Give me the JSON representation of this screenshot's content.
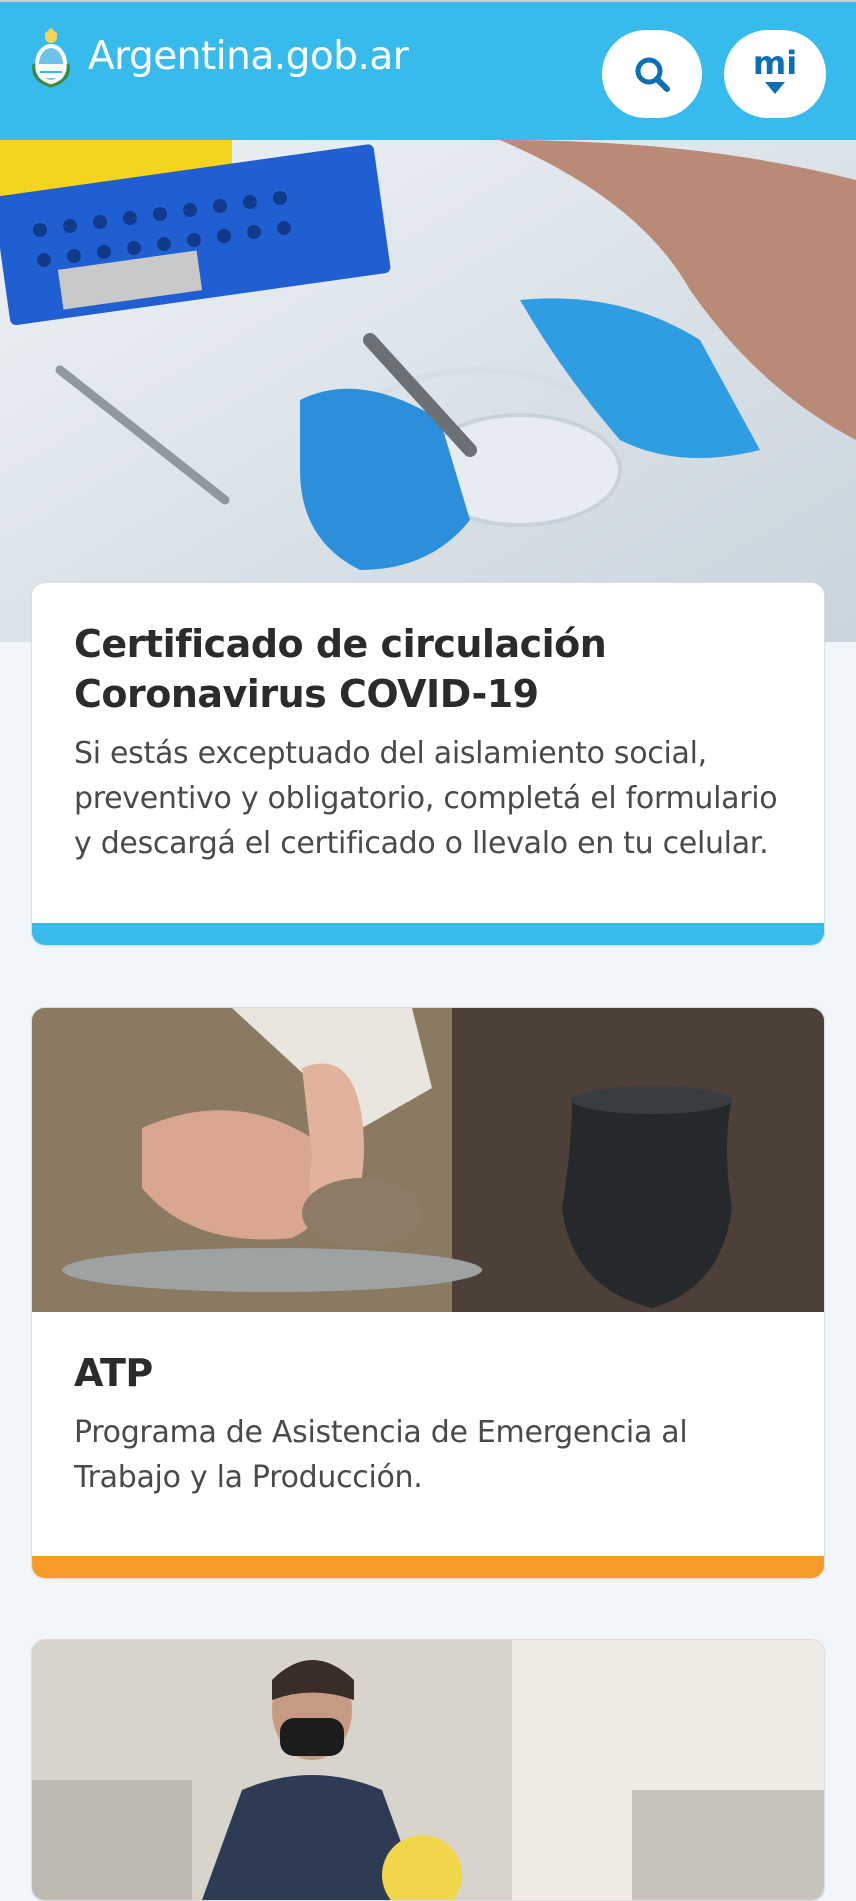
{
  "header": {
    "brand": "Argentina.gob.ar",
    "search_icon": "search-icon",
    "mi_label": "mi",
    "colors": {
      "header_bg": "#37bbed",
      "accent_blue": "#0c6fb4"
    }
  },
  "hero": {
    "image": "laboratory-petri-dish-photo"
  },
  "cards": [
    {
      "title": "Certificado de circulación Coronavirus COVID-19",
      "description": "Si estás exceptuado del aislamiento social, preventivo y obligatorio, completá el formulario y descargá el certificado o llevalo en tu celular.",
      "stripe_color": "#37bbed"
    },
    {
      "image": "pottery-hands-photo",
      "title": "ATP",
      "description": "Programa de Asistencia de Emergencia al Trabajo y la Producción.",
      "stripe_color": "#f79a28"
    },
    {
      "image": "worker-with-mask-photo"
    }
  ]
}
